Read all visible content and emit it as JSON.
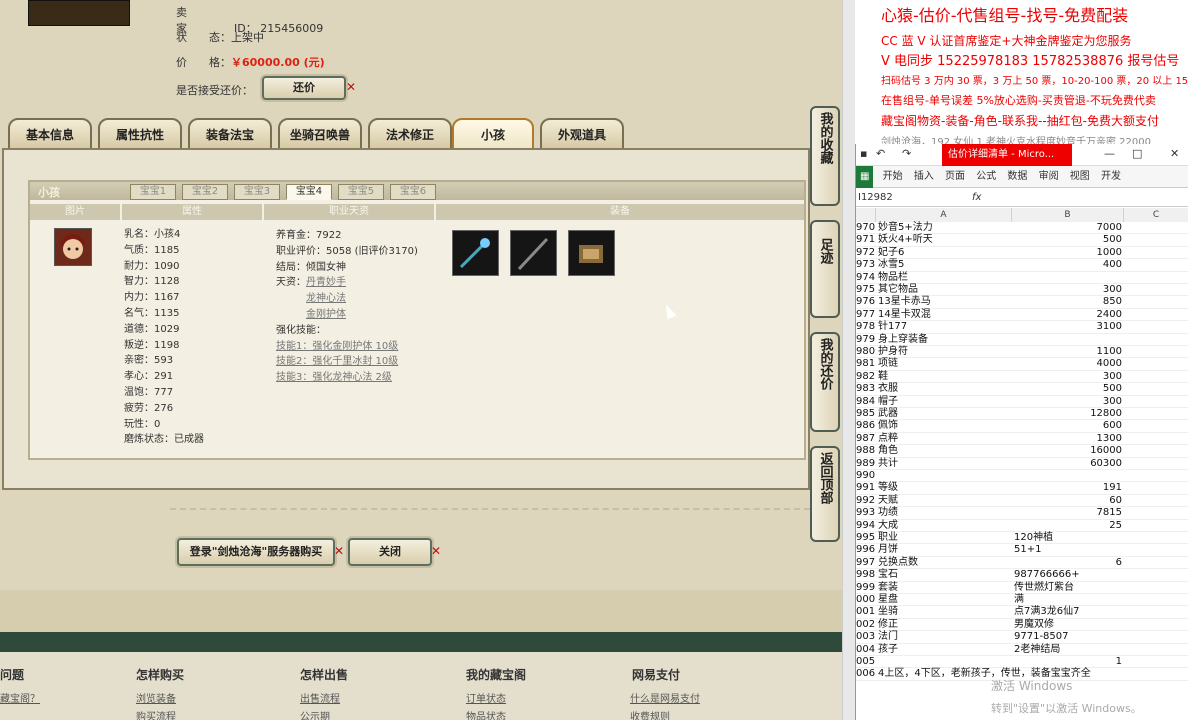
{
  "seller": {
    "label_seller": "卖　家",
    "label_id": "ID：",
    "id": "215456009",
    "label_status": "状　　态：",
    "status": "上架中",
    "label_price": "价　　格：",
    "price": "￥60000.00 (元)",
    "label_bargain": "是否接受还价：",
    "bargain_btn": "还价"
  },
  "tabs": [
    "基本信息",
    "属性抗性",
    "装备法宝",
    "坐骑召唤兽",
    "法术修正",
    "小孩",
    "外观道具"
  ],
  "child": {
    "panel_title": "小孩",
    "baby_tabs": [
      "宝宝1",
      "宝宝2",
      "宝宝3",
      "宝宝4",
      "宝宝5",
      "宝宝6"
    ],
    "col_headers": [
      "图片",
      "属性",
      "职业天资",
      "装备"
    ],
    "stats": [
      "乳名：小孩4",
      "气质：1185",
      "耐力：1090",
      "智力：1128",
      "内力：1167",
      "名气：1135",
      "道德：1029",
      "叛逆：1198",
      "亲密：593",
      "孝心：291",
      "温饱：777",
      "疲劳：276",
      "玩性：0",
      "磨炼状态：已成器"
    ],
    "mid": {
      "l1": "养育金：7922",
      "l2": "职业评价：5058 (旧评价3170)",
      "l3": "结局：倾国女神",
      "l4": "天资：",
      "t1": "丹青妙手",
      "t2": "龙神心法",
      "t3": "金刚护体",
      "l5": "强化技能：",
      "s1": "技能1：强化金刚护体 10级",
      "s2": "技能2：强化千里冰封 10级",
      "s3": "技能3：强化龙神心法 2级"
    }
  },
  "buttons": {
    "login": "登录\"剑烛沧海\"服务器购买",
    "close": "关闭"
  },
  "side": {
    "fav": "我的收藏",
    "trace": "足迹",
    "bargain": "我的还价",
    "top": "返回顶部"
  },
  "footer": {
    "cols": [
      "问题",
      "怎样购买",
      "怎样出售",
      "我的藏宝阁",
      "网易支付"
    ],
    "links": [
      "藏宝阁？",
      "浏览装备",
      "出售流程",
      "订单状态",
      "什么是网易支付",
      "购买流程",
      "公示期",
      "物品状态",
      "收费规则"
    ]
  },
  "note": [
    "心猿-估价-代售组号-找号-免费配装",
    "CC 蓝 V 认证首席鉴定+大神金牌鉴定为您服务",
    "V 电同步 15225978183 15782538876 报号估号",
    "扫码估号 3 万内 30 票，3 万上 50 票，10-20-100 票，20 以上 150",
    "在售组号-单号误差 5%放心选购-买责管退-不玩免费代卖",
    "藏宝阁物资-装备-角色-联系我--抽红包-免费大额支付",
    "剑烛沧海，192 女仙 1 老神火克水程度妙音千万亲密 22000"
  ],
  "excel": {
    "doc_title": "估价详细清单 - Micro...",
    "ribbon": [
      "开始",
      "插入",
      "页面",
      "公式",
      "数据",
      "审阅",
      "视图",
      "开发"
    ],
    "cell_ref": "I12982",
    "fx": "fx",
    "rows": [
      [
        "970",
        "妙音5+法力",
        "7000"
      ],
      [
        "971",
        "妖火4+听天",
        "500"
      ],
      [
        "972",
        "妃子6",
        "1000"
      ],
      [
        "973",
        "冰雪5",
        "400"
      ],
      [
        "974",
        "物品栏",
        ""
      ],
      [
        "975",
        "其它物品",
        "300"
      ],
      [
        "976",
        "13星卡赤马",
        "850"
      ],
      [
        "977",
        "14星卡双混",
        "2400"
      ],
      [
        "978",
        "针177",
        "3100"
      ],
      [
        "979",
        "身上穿装备",
        ""
      ],
      [
        "980",
        "护身符",
        "1100"
      ],
      [
        "981",
        "项链",
        "4000"
      ],
      [
        "982",
        "鞋",
        "300"
      ],
      [
        "983",
        "衣服",
        "500"
      ],
      [
        "984",
        "帽子",
        "300"
      ],
      [
        "985",
        "武器",
        "12800"
      ],
      [
        "986",
        "佩饰",
        "600"
      ],
      [
        "987",
        "点粹",
        "1300"
      ],
      [
        "988",
        "角色",
        "16000"
      ],
      [
        "989",
        "共计",
        "60300"
      ],
      [
        "990",
        "",
        ""
      ],
      [
        "991",
        "等级",
        "191"
      ],
      [
        "992",
        "天赋",
        "60"
      ],
      [
        "993",
        "功绩",
        "7815"
      ],
      [
        "994",
        "大成",
        "25"
      ],
      [
        "995",
        "职业",
        "120神植"
      ],
      [
        "996",
        "月饼",
        "51+1"
      ],
      [
        "997",
        "兑换点数",
        "6"
      ],
      [
        "998",
        "宝石",
        "987766666+"
      ],
      [
        "999",
        "套装",
        "传世燃灯紫台"
      ],
      [
        "000",
        "星盘",
        "满"
      ],
      [
        "001",
        "坐骑",
        "点7满3龙6仙7"
      ],
      [
        "002",
        "修正",
        "男魔双修"
      ],
      [
        "003",
        "法门",
        "9771-8507"
      ],
      [
        "004",
        "孩子",
        "2老神结局"
      ],
      [
        "005",
        "",
        "1"
      ],
      [
        "006",
        "4上区，4下区，老新孩子，传世，装备宝宝齐全",
        ""
      ]
    ],
    "watermark": "激活 Windows",
    "watermark2": "转到\"设置\"以激活 Windows。"
  }
}
